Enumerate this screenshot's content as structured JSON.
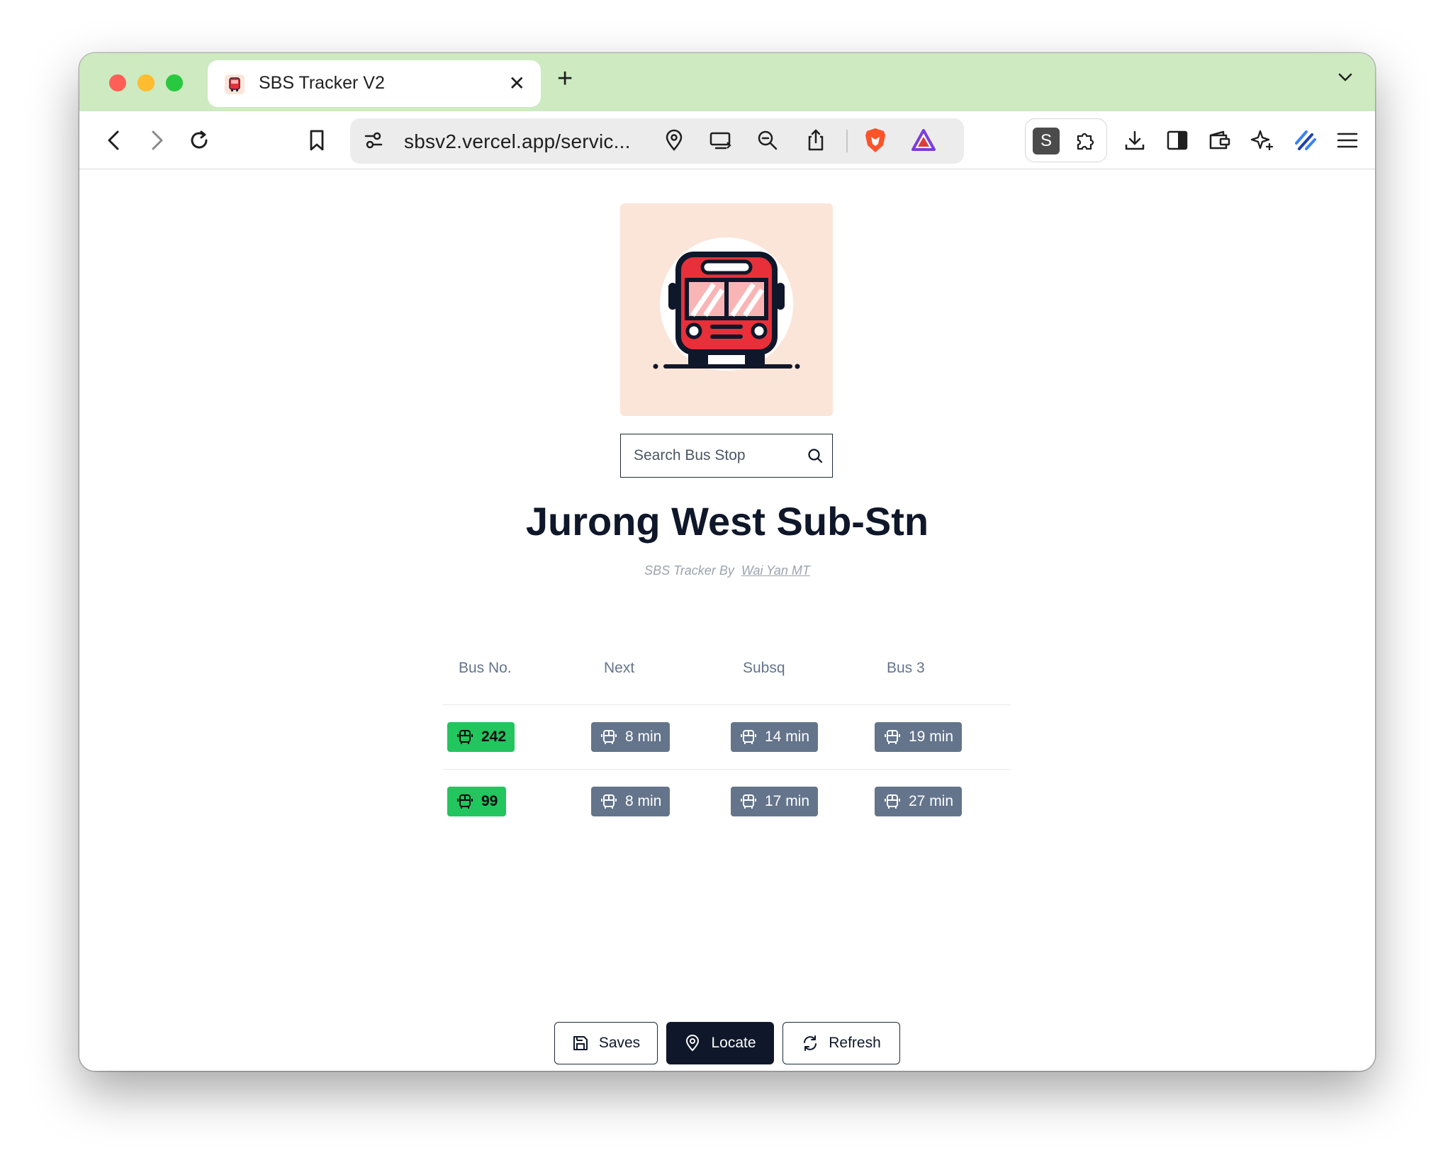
{
  "browser": {
    "tab_title": "SBS Tracker V2",
    "tab_close": "✕",
    "new_tab": "+",
    "url": "sbsv2.vercel.app/servic...",
    "extension_s_label": "S"
  },
  "app": {
    "search": {
      "placeholder": "Search Bus Stop"
    },
    "title": "Jurong West Sub-Stn",
    "byline": {
      "prefix": "SBS Tracker By",
      "author": "Wai Yan MT"
    },
    "table": {
      "headers": [
        "Bus No.",
        "Next",
        "Subsq",
        "Bus 3"
      ],
      "rows": [
        {
          "bus": "242",
          "next": "8 min",
          "subsq": "14 min",
          "bus3": "19 min"
        },
        {
          "bus": "99",
          "next": "8 min",
          "subsq": "17 min",
          "bus3": "27 min"
        }
      ]
    },
    "actions": {
      "saves": "Saves",
      "locate": "Locate",
      "refresh": "Refresh"
    }
  },
  "colors": {
    "tabbar": "#cdeac0",
    "bus_badge": "#22c55e",
    "time_badge": "#64748b",
    "primary": "#0f172a",
    "logo_bg": "#fbe5d9",
    "bus_red": "#e8303a"
  }
}
